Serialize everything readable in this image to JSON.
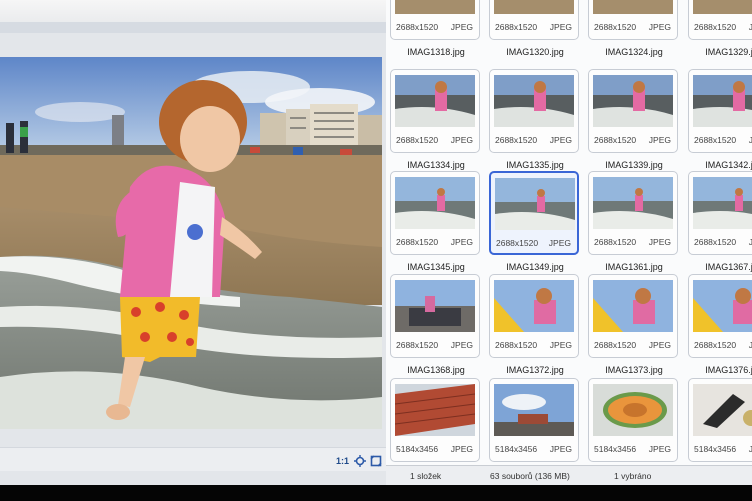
{
  "preview": {
    "zoom_label": "1:1",
    "tools": [
      {
        "icon": "fit-to-window-icon"
      },
      {
        "icon": "fullscreen-icon"
      }
    ]
  },
  "thumbnails": {
    "rows": [
      {
        "items": [
          {
            "dims": "2688x1520",
            "format": "JPEG",
            "name": "IMAG1318.jpg",
            "scene": "beach"
          },
          {
            "dims": "2688x1520",
            "format": "JPEG",
            "name": "IMAG1320.jpg",
            "scene": "beach"
          },
          {
            "dims": "2688x1520",
            "format": "JPEG",
            "name": "IMAG1324.jpg",
            "scene": "beach"
          },
          {
            "dims": "2688x1520",
            "format": "JPEG",
            "name": "IMAG1329.jpg",
            "scene": "beach"
          }
        ]
      },
      {
        "items": [
          {
            "dims": "2688x1520",
            "format": "JPEG",
            "name": "IMAG1334.jpg",
            "scene": "wave"
          },
          {
            "dims": "2688x1520",
            "format": "JPEG",
            "name": "IMAG1335.jpg",
            "scene": "wave"
          },
          {
            "dims": "2688x1520",
            "format": "JPEG",
            "name": "IMAG1339.jpg",
            "scene": "wave"
          },
          {
            "dims": "2688x1520",
            "format": "JPEG",
            "name": "IMAG1342.jpg",
            "scene": "wave"
          }
        ]
      },
      {
        "items": [
          {
            "dims": "2688x1520",
            "format": "JPEG",
            "name": "IMAG1345.jpg",
            "scene": "shore"
          },
          {
            "dims": "2688x1520",
            "format": "JPEG",
            "name": "IMAG1349.jpg",
            "scene": "shore",
            "selected": true
          },
          {
            "dims": "2688x1520",
            "format": "JPEG",
            "name": "IMAG1361.jpg",
            "scene": "shore"
          },
          {
            "dims": "2688x1520",
            "format": "JPEG",
            "name": "IMAG1367.jpg",
            "scene": "shore"
          }
        ]
      },
      {
        "items": [
          {
            "dims": "2688x1520",
            "format": "JPEG",
            "name": "IMAG1368.jpg",
            "scene": "slide-dark"
          },
          {
            "dims": "2688x1520",
            "format": "JPEG",
            "name": "IMAG1372.jpg",
            "scene": "slide"
          },
          {
            "dims": "2688x1520",
            "format": "JPEG",
            "name": "IMAG1373.jpg",
            "scene": "slide"
          },
          {
            "dims": "2688x1520",
            "format": "JPEG",
            "name": "IMAG1376.jpg",
            "scene": "slide"
          }
        ]
      },
      {
        "items": [
          {
            "dims": "5184x3456",
            "format": "JPEG",
            "scene": "roof"
          },
          {
            "dims": "5184x3456",
            "format": "JPEG",
            "scene": "sky"
          },
          {
            "dims": "5184x3456",
            "format": "JPEG",
            "scene": "melon"
          },
          {
            "dims": "5184x3456",
            "format": "JPEG",
            "scene": "stilllife"
          }
        ]
      }
    ]
  },
  "status": {
    "folders": "1 složek",
    "files": "63 souborů (136 MB)",
    "selected": "1 vybráno"
  }
}
